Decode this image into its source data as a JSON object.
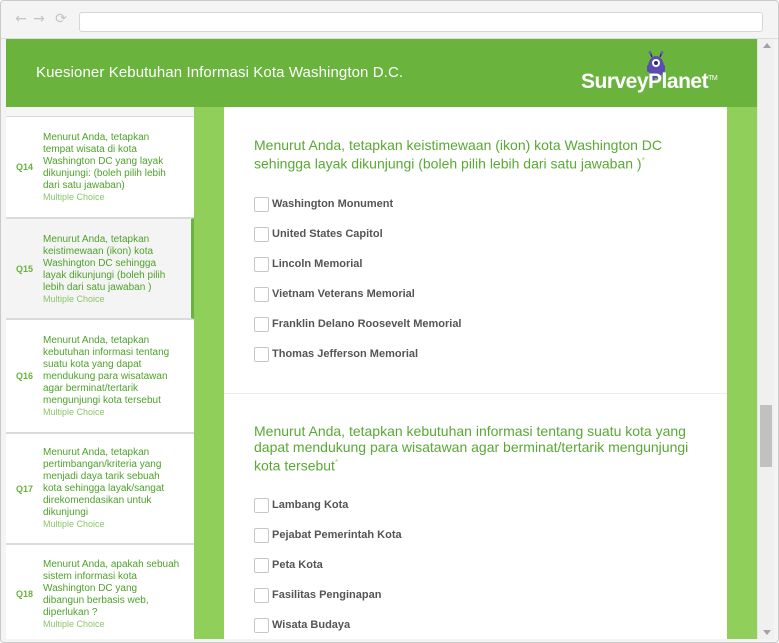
{
  "browser": {
    "back_icon": "←",
    "forward_icon": "→",
    "reload_icon": "⟳"
  },
  "header": {
    "title": "Kuesioner Kebutuhan Informasi Kota Washington D.C.",
    "logo_text": "SurveyPlanet",
    "logo_tm": "TM",
    "color": "#6ab43e"
  },
  "sidebar": {
    "items": [
      {
        "number": "Q14",
        "text": "Menurut Anda, tetapkan tempat wisata di kota Washington DC yang layak dikunjungi: (boleh pilih lebih dari satu jawaban)",
        "type": "Multiple Choice",
        "active": false
      },
      {
        "number": "Q15",
        "text": "Menurut Anda, tetapkan keistimewaan (ikon) kota Washington DC sehingga layak dikunjungi (boleh pilih lebih dari satu jawaban )",
        "type": "Multiple Choice",
        "active": true
      },
      {
        "number": "Q16",
        "text": "Menurut Anda, tetapkan kebutuhan informasi tentang suatu kota yang dapat mendukung para wisatawan agar berminat/tertarik mengunjungi kota tersebut",
        "type": "Multiple Choice",
        "active": false
      },
      {
        "number": "Q17",
        "text": "Menurut Anda, tetapkan pertimbangan/kriteria yang menjadi daya tarik sebuah kota sehingga layak/sangat direkomendasikan untuk dikunjungi",
        "type": "Multiple Choice",
        "active": false
      },
      {
        "number": "Q18",
        "text": "Menurut Anda, apakah sebuah sistem informasi kota Washington DC yang dibangun berbasis web, diperlukan ?",
        "type": "Multiple Choice",
        "active": false
      }
    ]
  },
  "main": {
    "questions": [
      {
        "text": "Menurut Anda, tetapkan keistimewaan (ikon) kota Washington DC sehingga layak dikunjungi (boleh pilih lebih dari satu jawaban )",
        "required_mark": "*",
        "options": [
          "Washington Monument",
          "United States Capitol",
          "Lincoln Memorial",
          "Vietnam Veterans Memorial",
          "Franklin Delano Roosevelt Memorial",
          "Thomas Jefferson Memorial"
        ]
      },
      {
        "text": "Menurut Anda, tetapkan kebutuhan informasi tentang suatu kota yang dapat mendukung para wisatawan agar berminat/tertarik mengunjungi kota tersebut",
        "required_mark": "*",
        "options": [
          "Lambang Kota",
          "Pejabat Pemerintah Kota",
          "Peta Kota",
          "Fasilitas Penginapan",
          "Wisata Budaya"
        ]
      }
    ]
  }
}
